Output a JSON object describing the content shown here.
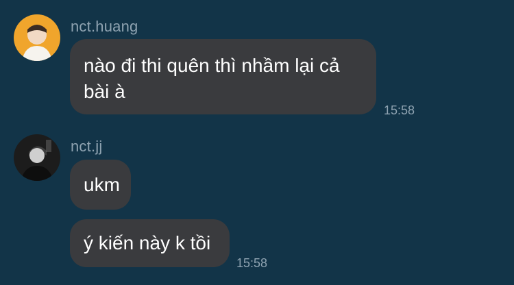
{
  "messages": [
    {
      "sender": "nct.huang",
      "avatar_icon": "avatar-photo-icon",
      "bubbles": [
        {
          "text": "nào đi thi quên thì nhầm lại cả\nbài à"
        }
      ],
      "time": "15:58"
    },
    {
      "sender": "nct.jj",
      "avatar_icon": "avatar-photo-icon",
      "bubbles": [
        {
          "text": "ukm"
        },
        {
          "text": "ý kiến này k tồi"
        }
      ],
      "time": "15:58"
    }
  ],
  "colors": {
    "background": "#123448",
    "bubble": "#3a3b3e",
    "meta_text": "#8fa3b1",
    "message_text": "#ffffff"
  }
}
